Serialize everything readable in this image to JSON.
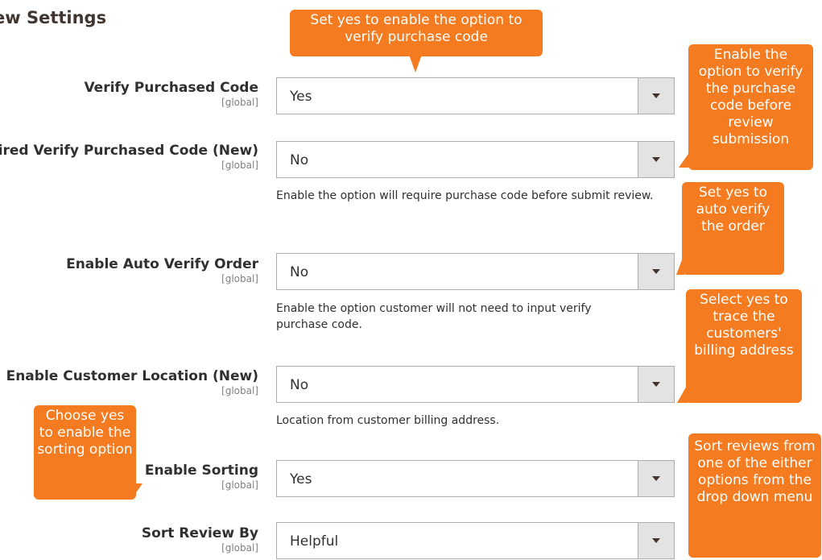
{
  "section": {
    "title": "ew Settings"
  },
  "rows": [
    {
      "label": "Verify Purchased Code",
      "scope": "[global]",
      "value": "Yes"
    },
    {
      "label": "ired Verify Purchased Code (New)",
      "scope": "[global]",
      "value": "No",
      "note": "Enable the option will require purchase code before submit review."
    },
    {
      "label": "Enable Auto Verify Order",
      "scope": "[global]",
      "value": "No",
      "note": "Enable the option customer will not need to input verify purchase code."
    },
    {
      "label": "Enable Customer Location (New)",
      "scope": "[global]",
      "value": "No",
      "note": "Location from customer billing address."
    },
    {
      "label": "Enable Sorting",
      "scope": "[global]",
      "value": "Yes"
    },
    {
      "label": "Sort Review By",
      "scope": "[global]",
      "value": "Helpful"
    }
  ],
  "callouts": {
    "verify_code": "Set yes to enable the option to verify purchase code",
    "before_submission": "Enable the option to verify the purchase code before review submission",
    "auto_verify": "Set yes to auto verify the order",
    "trace_location": "Select yes to trace the customers' billing address",
    "sorting": "Choose yes to enable the sorting option",
    "sort_by": "Sort reviews from one of the either options from the drop down menu"
  },
  "colors": {
    "callout": "#f47b20",
    "arrow_bg": "#e3e3e3",
    "border": "#adadad"
  },
  "icons": {
    "dropdown": "chevron-down-icon"
  }
}
